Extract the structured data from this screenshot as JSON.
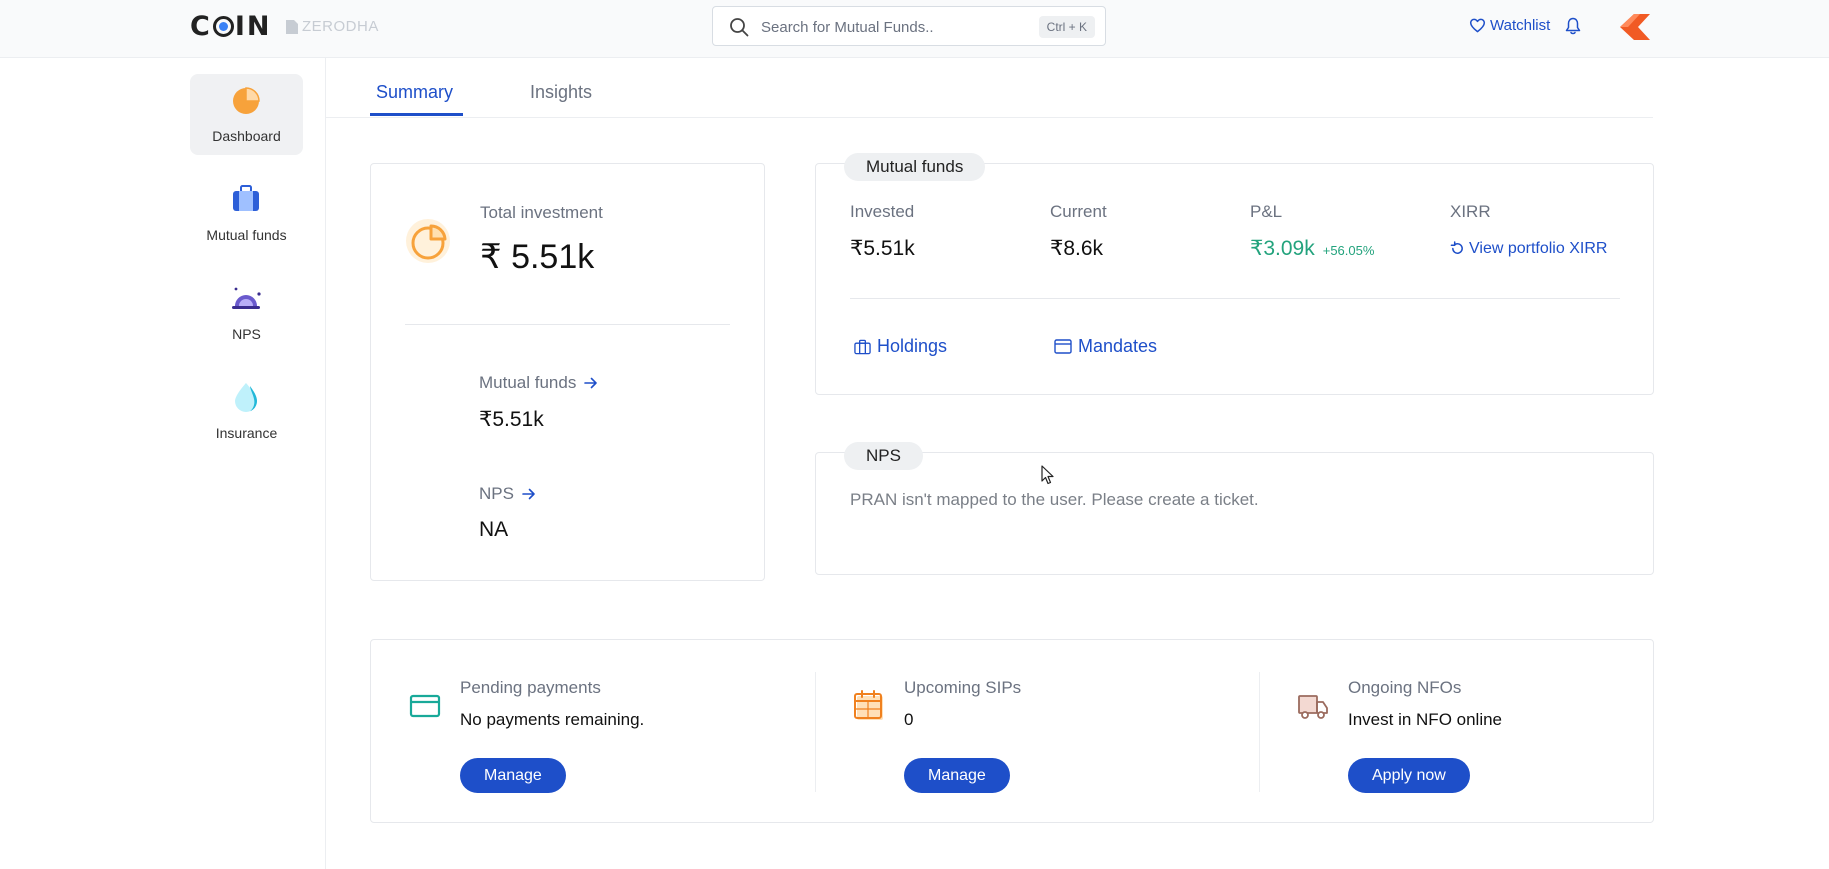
{
  "header": {
    "logo_text": "COIN",
    "brand": "ZERODHA",
    "search": {
      "placeholder": "Search for Mutual Funds..",
      "shortcut": "Ctrl + K"
    },
    "watchlist_label": "Watchlist"
  },
  "sidebar": {
    "items": [
      {
        "label": "Dashboard",
        "icon": "pie-chart-icon",
        "active": true
      },
      {
        "label": "Mutual funds",
        "icon": "briefcase-icon"
      },
      {
        "label": "NPS",
        "icon": "sunrise-icon"
      },
      {
        "label": "Insurance",
        "icon": "droplet-icon"
      }
    ]
  },
  "tabs": [
    {
      "label": "Summary",
      "active": true
    },
    {
      "label": "Insights"
    }
  ],
  "summary": {
    "total_label": "Total investment",
    "total_value": "₹ 5.51k",
    "mf_label": "Mutual funds",
    "mf_value": "₹5.51k",
    "nps_label": "NPS",
    "nps_value": "NA"
  },
  "mutual_funds": {
    "title": "Mutual funds",
    "invested_label": "Invested",
    "invested_value": "₹5.51k",
    "current_label": "Current",
    "current_value": "₹8.6k",
    "pl_label": "P&L",
    "pl_value": "₹3.09k",
    "pl_percent": "+56.05%",
    "xirr_label": "XIRR",
    "xirr_link": "View portfolio XIRR",
    "holdings_label": "Holdings",
    "mandates_label": "Mandates"
  },
  "nps": {
    "title": "NPS",
    "message": "PRAN isn't mapped to the user. Please create a ticket."
  },
  "bottom": {
    "pending": {
      "label": "Pending payments",
      "value": "No payments remaining.",
      "button": "Manage"
    },
    "sips": {
      "label": "Upcoming SIPs",
      "value": "0",
      "button": "Manage"
    },
    "nfos": {
      "label": "Ongoing NFOs",
      "value": "Invest in NFO online",
      "button": "Apply now"
    }
  },
  "colors": {
    "accent": "#1e4fc9",
    "profit": "#23a37d",
    "dashboard_icon": "#f7a23b",
    "kite_orange": "#f15a24"
  }
}
